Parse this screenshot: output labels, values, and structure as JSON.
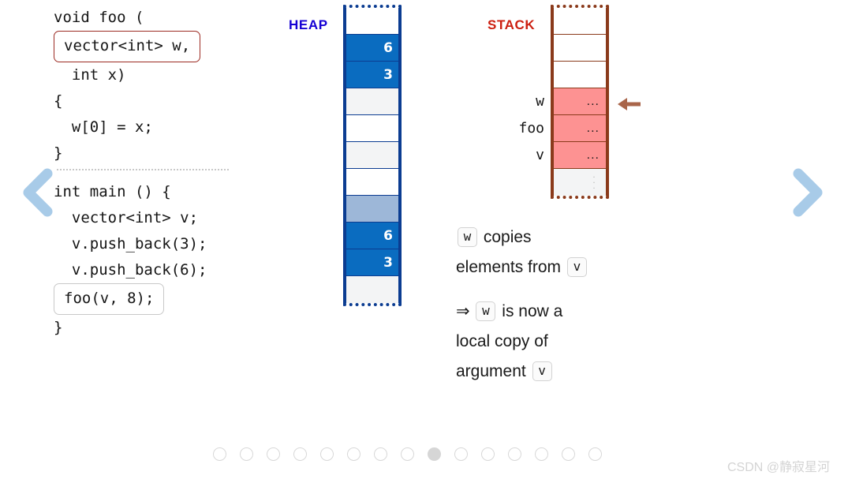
{
  "nav": {
    "prev_label": "previous-slide",
    "next_label": "next-slide"
  },
  "code": {
    "function_lines": [
      "void foo (",
      "vector<int> w,",
      "  int x)",
      "{",
      "  w[0] = x;",
      "}"
    ],
    "main_lines": [
      "int main () {",
      "  vector<int> v;",
      "  v.push_back(3);",
      "  v.push_back(6);",
      "foo(v, 8);",
      "}"
    ],
    "highlight_param": "vector<int> w,",
    "highlight_call": "foo(v, 8);"
  },
  "heap": {
    "label": "HEAP",
    "label_color": "#1500d4",
    "border_color": "#0b3c91",
    "cells": [
      {
        "fill": "white",
        "value": ""
      },
      {
        "fill": "blue",
        "value": "6"
      },
      {
        "fill": "blue",
        "value": "3"
      },
      {
        "fill": "gray",
        "value": ""
      },
      {
        "fill": "white",
        "value": ""
      },
      {
        "fill": "gray",
        "value": ""
      },
      {
        "fill": "white",
        "value": ""
      },
      {
        "fill": "lblue",
        "value": ""
      },
      {
        "fill": "blue",
        "value": "6"
      },
      {
        "fill": "blue",
        "value": "3"
      },
      {
        "fill": "gray",
        "value": ""
      }
    ]
  },
  "stack": {
    "label": "STACK",
    "label_color": "#cc1f10",
    "border_color": "#8a3a1b",
    "arrow_color": "#a9654a",
    "cells": [
      {
        "fill": "white",
        "label": "",
        "marker": ""
      },
      {
        "fill": "white",
        "label": "",
        "marker": ""
      },
      {
        "fill": "white",
        "label": "",
        "marker": ""
      },
      {
        "fill": "pink",
        "label": "w",
        "marker": "..."
      },
      {
        "fill": "pink",
        "label": "foo",
        "marker": "..."
      },
      {
        "fill": "pink",
        "label": "v",
        "marker": "..."
      },
      {
        "fill": "gray",
        "label": "",
        "marker": "vdots"
      }
    ]
  },
  "explanation": {
    "line1_chip": "w",
    "line1_text": "copies",
    "line2_text": "elements from",
    "line2_chip": "v",
    "line3_arrow": "⇒",
    "line3_chip": "w",
    "line3_text": "is now a",
    "line4_text": "local copy of",
    "line5_text": "argument",
    "line5_chip": "v"
  },
  "pagination": {
    "total": 15,
    "active_index": 8
  },
  "watermark": {
    "text": "CSDN @静寂星河"
  }
}
